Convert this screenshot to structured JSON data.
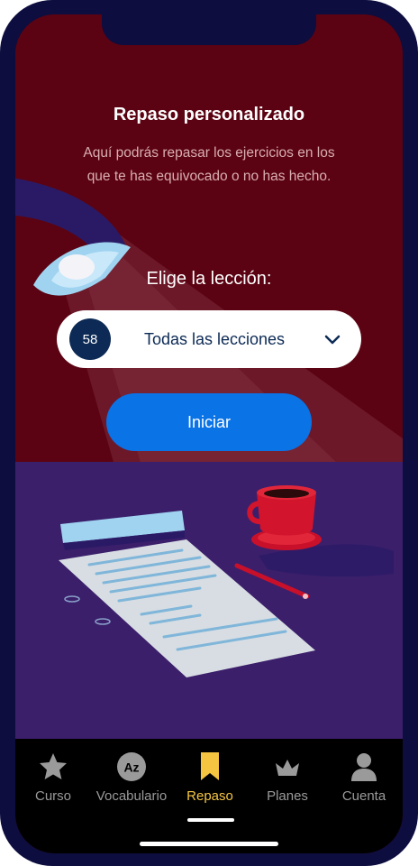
{
  "review": {
    "title": "Repaso personalizado",
    "description": "Aquí podrás repasar los ejercicios en los que te has equivocado o no has hecho.",
    "choose_label": "Elige la lección:",
    "lesson_select": {
      "count": "58",
      "selected": "Todas las lecciones"
    },
    "start_button": "Iniciar"
  },
  "tabbar": {
    "tabs": [
      {
        "label": "Curso",
        "icon": "star-icon",
        "active": false
      },
      {
        "label": "Vocabulario",
        "icon": "az-icon",
        "active": false
      },
      {
        "label": "Repaso",
        "icon": "bookmark-icon",
        "active": true
      },
      {
        "label": "Planes",
        "icon": "crown-icon",
        "active": false
      },
      {
        "label": "Cuenta",
        "icon": "person-icon",
        "active": false
      }
    ]
  },
  "colors": {
    "background_top": "#5b0312",
    "desk": "#3b1f6b",
    "primary": "#0a73e6",
    "badge": "#0c2a55",
    "active_tab": "#f5c542"
  }
}
